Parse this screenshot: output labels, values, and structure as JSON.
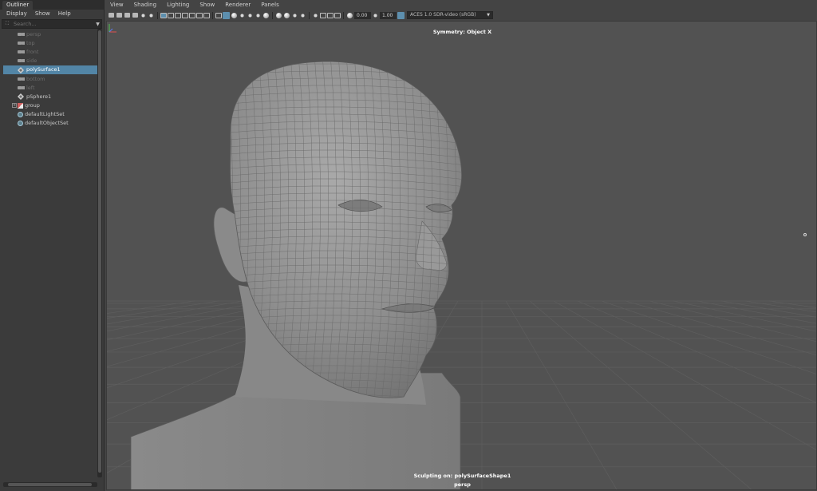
{
  "outliner": {
    "tab_label": "Outliner",
    "menu": [
      "Display",
      "Show",
      "Help"
    ],
    "search": {
      "placeholder": "Search...",
      "value": ""
    },
    "items": [
      {
        "label": "persp",
        "icon": "camera-icon",
        "state": "dim"
      },
      {
        "label": "top",
        "icon": "camera-icon",
        "state": "dim"
      },
      {
        "label": "front",
        "icon": "camera-icon",
        "state": "dim"
      },
      {
        "label": "side",
        "icon": "camera-icon",
        "state": "dim"
      },
      {
        "label": "polySurface1",
        "icon": "mesh-icon",
        "state": "selected"
      },
      {
        "label": "bottom",
        "icon": "camera-icon",
        "state": "dim"
      },
      {
        "label": "left",
        "icon": "camera-icon",
        "state": "dim"
      },
      {
        "label": "pSphere1",
        "icon": "mesh-icon",
        "state": "normal"
      },
      {
        "label": "group",
        "icon": "group-icon",
        "state": "normal",
        "expandable": true
      },
      {
        "label": "defaultLightSet",
        "icon": "set-icon",
        "state": "normal"
      },
      {
        "label": "defaultObjectSet",
        "icon": "set-icon",
        "state": "normal"
      }
    ]
  },
  "viewport": {
    "menu": [
      "View",
      "Shading",
      "Lighting",
      "Show",
      "Renderer",
      "Panels"
    ],
    "toolbar": {
      "exposure_value": "0.00",
      "gamma_value": "1.00",
      "color_space": "ACES 1.0 SDR-video (sRGB)"
    },
    "hud": {
      "symmetry": "Symmetry: Object X",
      "sculpting": "Sculpting on: polySurfaceShape1",
      "camera": "persp"
    }
  },
  "colors": {
    "selection": "#5285a6",
    "panel_bg": "#444444",
    "viewport_bg": "#525252",
    "mesh": "#8f8f8f",
    "grid": "#5e5e5e"
  }
}
